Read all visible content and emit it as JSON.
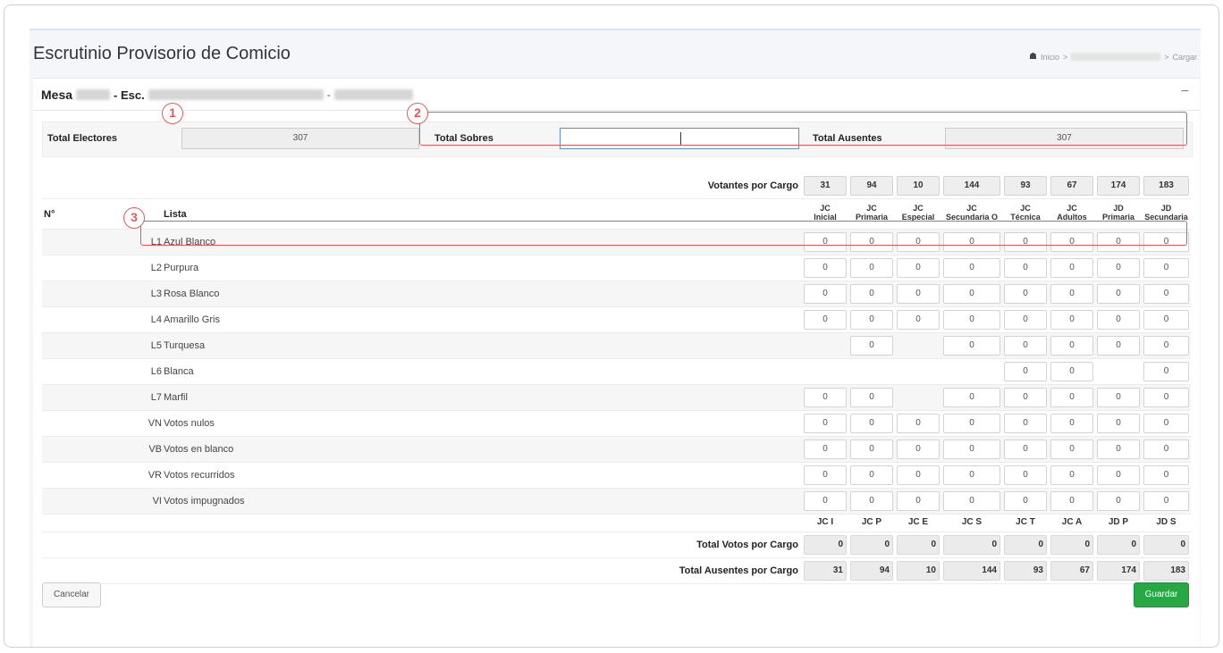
{
  "page": {
    "title": "Escrutinio Provisorio de Comicio"
  },
  "breadcrumb": {
    "home": "Inicio",
    "sep1": ">",
    "sep2": ">",
    "current": "Cargar"
  },
  "card": {
    "mesa_label": "Mesa",
    "esc_label": "- Esc.",
    "dash": "-",
    "collapse": "−"
  },
  "totals": {
    "electores_label": "Total Electores",
    "electores_value": "307",
    "sobres_label": "Total Sobres",
    "sobres_value": "",
    "ausentes_label": "Total Ausentes",
    "ausentes_value": "307"
  },
  "annotations": [
    "1",
    "2",
    "3"
  ],
  "table": {
    "votantes_label": "Votantes por Cargo",
    "votantes": [
      "31",
      "94",
      "10",
      "144",
      "93",
      "67",
      "174",
      "183"
    ],
    "col_num": "N°",
    "col_lista": "Lista",
    "cargos": [
      [
        "JC",
        "Inicial"
      ],
      [
        "JC",
        "Primaria"
      ],
      [
        "JC",
        "Especial"
      ],
      [
        "JC",
        "Secundaria O"
      ],
      [
        "JC",
        "Técnica"
      ],
      [
        "JC",
        "Adultos"
      ],
      [
        "JD",
        "Primaria"
      ],
      [
        "JD",
        "Secundaria"
      ]
    ],
    "rows": [
      {
        "code": "L1",
        "name": "Azul Blanco",
        "values": [
          "0",
          "0",
          "0",
          "0",
          "0",
          "0",
          "0",
          "0"
        ]
      },
      {
        "code": "L2",
        "name": "Purpura",
        "values": [
          "0",
          "0",
          "0",
          "0",
          "0",
          "0",
          "0",
          "0"
        ]
      },
      {
        "code": "L3",
        "name": "Rosa Blanco",
        "values": [
          "0",
          "0",
          "0",
          "0",
          "0",
          "0",
          "0",
          "0"
        ]
      },
      {
        "code": "L4",
        "name": "Amarillo Gris",
        "values": [
          "0",
          "0",
          "0",
          "0",
          "0",
          "0",
          "0",
          "0"
        ]
      },
      {
        "code": "L5",
        "name": "Turquesa",
        "values": [
          null,
          "0",
          null,
          "0",
          "0",
          "0",
          "0",
          "0"
        ]
      },
      {
        "code": "L6",
        "name": "Blanca",
        "values": [
          null,
          null,
          null,
          null,
          "0",
          "0",
          null,
          "0"
        ]
      },
      {
        "code": "L7",
        "name": "Marfil",
        "values": [
          "0",
          "0",
          null,
          "0",
          "0",
          "0",
          "0",
          "0"
        ]
      },
      {
        "code": "VN",
        "name": "Votos nulos",
        "values": [
          "0",
          "0",
          "0",
          "0",
          "0",
          "0",
          "0",
          "0"
        ]
      },
      {
        "code": "VB",
        "name": "Votos en blanco",
        "values": [
          "0",
          "0",
          "0",
          "0",
          "0",
          "0",
          "0",
          "0"
        ]
      },
      {
        "code": "VR",
        "name": "Votos recurridos",
        "values": [
          "0",
          "0",
          "0",
          "0",
          "0",
          "0",
          "0",
          "0"
        ]
      },
      {
        "code": "VI",
        "name": "Votos impugnados",
        "values": [
          "0",
          "0",
          "0",
          "0",
          "0",
          "0",
          "0",
          "0"
        ]
      }
    ],
    "abbrs": [
      "JC I",
      "JC P",
      "JC E",
      "JC S",
      "JC T",
      "JC A",
      "JD P",
      "JD S"
    ],
    "total_votos_label": "Total Votos por Cargo",
    "total_votos": [
      "0",
      "0",
      "0",
      "0",
      "0",
      "0",
      "0",
      "0"
    ],
    "total_ausentes_label": "Total Ausentes por Cargo",
    "total_ausentes": [
      "31",
      "94",
      "10",
      "144",
      "93",
      "67",
      "174",
      "183"
    ]
  },
  "buttons": {
    "cancel": "Cancelar",
    "save": "Guardar"
  }
}
